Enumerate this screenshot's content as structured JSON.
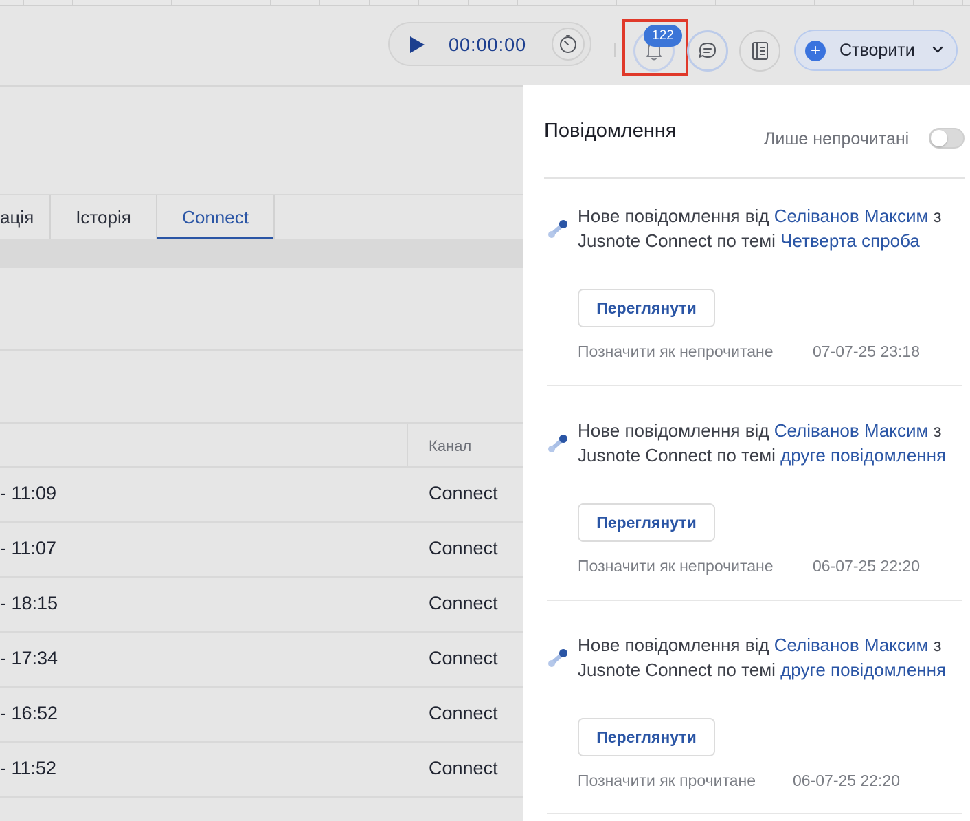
{
  "header": {
    "timer_value": "00:00:00",
    "notification_count": "122",
    "create_label": "Створити"
  },
  "tabs": [
    {
      "label": "ація"
    },
    {
      "label": "Історія"
    },
    {
      "label": "Connect",
      "active": true
    }
  ],
  "table": {
    "channel_header": "Канал",
    "rows": [
      {
        "time": "- 11:09",
        "channel": "Connect"
      },
      {
        "time": "- 11:07",
        "channel": "Connect"
      },
      {
        "time": "- 18:15",
        "channel": "Connect"
      },
      {
        "time": "- 17:34",
        "channel": "Connect"
      },
      {
        "time": "- 16:52",
        "channel": "Connect"
      },
      {
        "time": "- 11:52",
        "channel": "Connect"
      }
    ]
  },
  "notifications_panel": {
    "title": "Повідомлення",
    "unread_only_label": "Лише непрочитані",
    "items": [
      {
        "prefix": "Нове повідомлення від ",
        "sender": "Селіванов Максим",
        "middle": " з Jusnote Connect по темі ",
        "topic": "Четверта спроба",
        "view_label": "Переглянути",
        "mark_label": "Позначити як непрочитане",
        "date": "07-07-25 23:18"
      },
      {
        "prefix": "Нове повідомлення від ",
        "sender": "Селіванов Максим",
        "middle": " з Jusnote Connect по темі ",
        "topic": "друге повідомлення",
        "view_label": "Переглянути",
        "mark_label": "Позначити як непрочитане",
        "date": "06-07-25 22:20"
      },
      {
        "prefix": "Нове повідомлення від ",
        "sender": "Селіванов Максим",
        "middle": " з Jusnote Connect по темі ",
        "topic": "друге повідомлення",
        "view_label": "Переглянути",
        "mark_label": "Позначити як прочитане",
        "date": "06-07-25 22:20"
      }
    ]
  },
  "colors": {
    "accent": "#2a55a5",
    "badge": "#3b75d8",
    "highlight": "#e0392a"
  },
  "icons": {
    "play": "play-icon",
    "timer": "stopwatch-icon",
    "bell": "bell-icon",
    "chat": "chat-icon",
    "notes": "notes-icon",
    "plus": "plus-icon",
    "chevron": "chevron-down-icon",
    "notification": "connect-notification-icon"
  }
}
